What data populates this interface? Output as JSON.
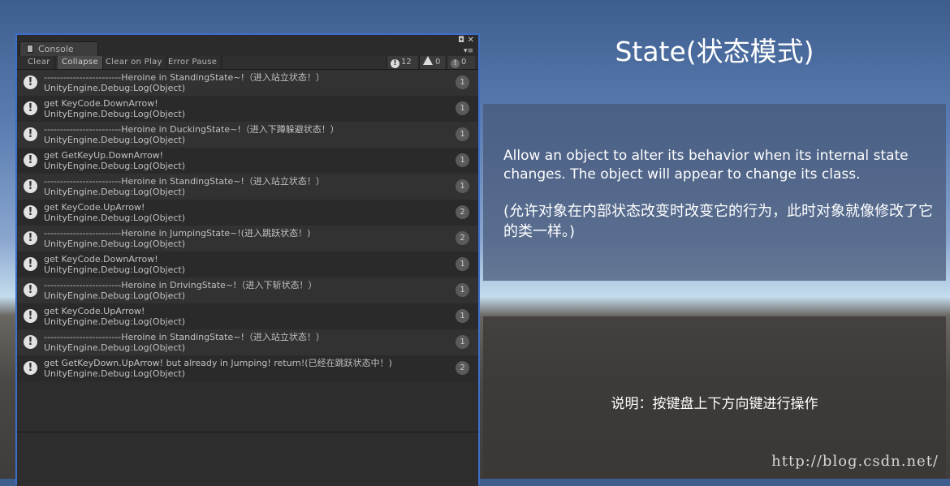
{
  "console": {
    "tab_label": "Console",
    "maximize_glyph": "◘",
    "close_glyph": "✕",
    "menu_glyph": "▾≡",
    "toolbar": {
      "clear": "Clear",
      "collapse": "Collapse",
      "clear_on_play": "Clear on Play",
      "error_pause": "Error Pause",
      "log_count": "12",
      "warning_count": "0",
      "error_count": "0"
    },
    "icon_glyph": "!",
    "logs": [
      {
        "line1": "------------------------Heroine in StandingState~!（进入站立状态！）",
        "line2": "UnityEngine.Debug:Log(Object)",
        "count": "1"
      },
      {
        "line1": "get KeyCode.DownArrow!",
        "line2": "UnityEngine.Debug:Log(Object)",
        "count": "1"
      },
      {
        "line1": "------------------------Heroine in DuckingState~!（进入下蹲躲避状态！）",
        "line2": "UnityEngine.Debug:Log(Object)",
        "count": "1"
      },
      {
        "line1": "get GetKeyUp.DownArrow!",
        "line2": "UnityEngine.Debug:Log(Object)",
        "count": "1"
      },
      {
        "line1": "------------------------Heroine in StandingState~!（进入站立状态！）",
        "line2": "UnityEngine.Debug:Log(Object)",
        "count": "1"
      },
      {
        "line1": "get KeyCode.UpArrow!",
        "line2": "UnityEngine.Debug:Log(Object)",
        "count": "2"
      },
      {
        "line1": "------------------------Heroine in JumpingState~!(进入跳跃状态！)",
        "line2": "UnityEngine.Debug:Log(Object)",
        "count": "2"
      },
      {
        "line1": "get KeyCode.DownArrow!",
        "line2": "UnityEngine.Debug:Log(Object)",
        "count": "1"
      },
      {
        "line1": "------------------------Heroine in DrivingState~!（进入下斩状态！）",
        "line2": "UnityEngine.Debug:Log(Object)",
        "count": "1"
      },
      {
        "line1": "get KeyCode.UpArrow!",
        "line2": "UnityEngine.Debug:Log(Object)",
        "count": "1"
      },
      {
        "line1": "------------------------Heroine in StandingState~!（进入站立状态！）",
        "line2": "UnityEngine.Debug:Log(Object)",
        "count": "1"
      },
      {
        "line1": "get GetKeyDown.UpArrow! but already in Jumping! return!(已经在跳跃状态中！)",
        "line2": "UnityEngine.Debug:Log(Object)",
        "count": "2"
      }
    ]
  },
  "game_view": {
    "title": "State(状态模式)",
    "description_en": "Allow an object to alter its behavior when its internal state changes. The object will appear to change its class.",
    "description_cn": "(允许对象在内部状态改变时改变它的行为，此时对象就像修改了它的类一样。)",
    "instruction": "说明：按键盘上下方向键进行操作"
  },
  "watermark": "http://blog.csdn.net/"
}
